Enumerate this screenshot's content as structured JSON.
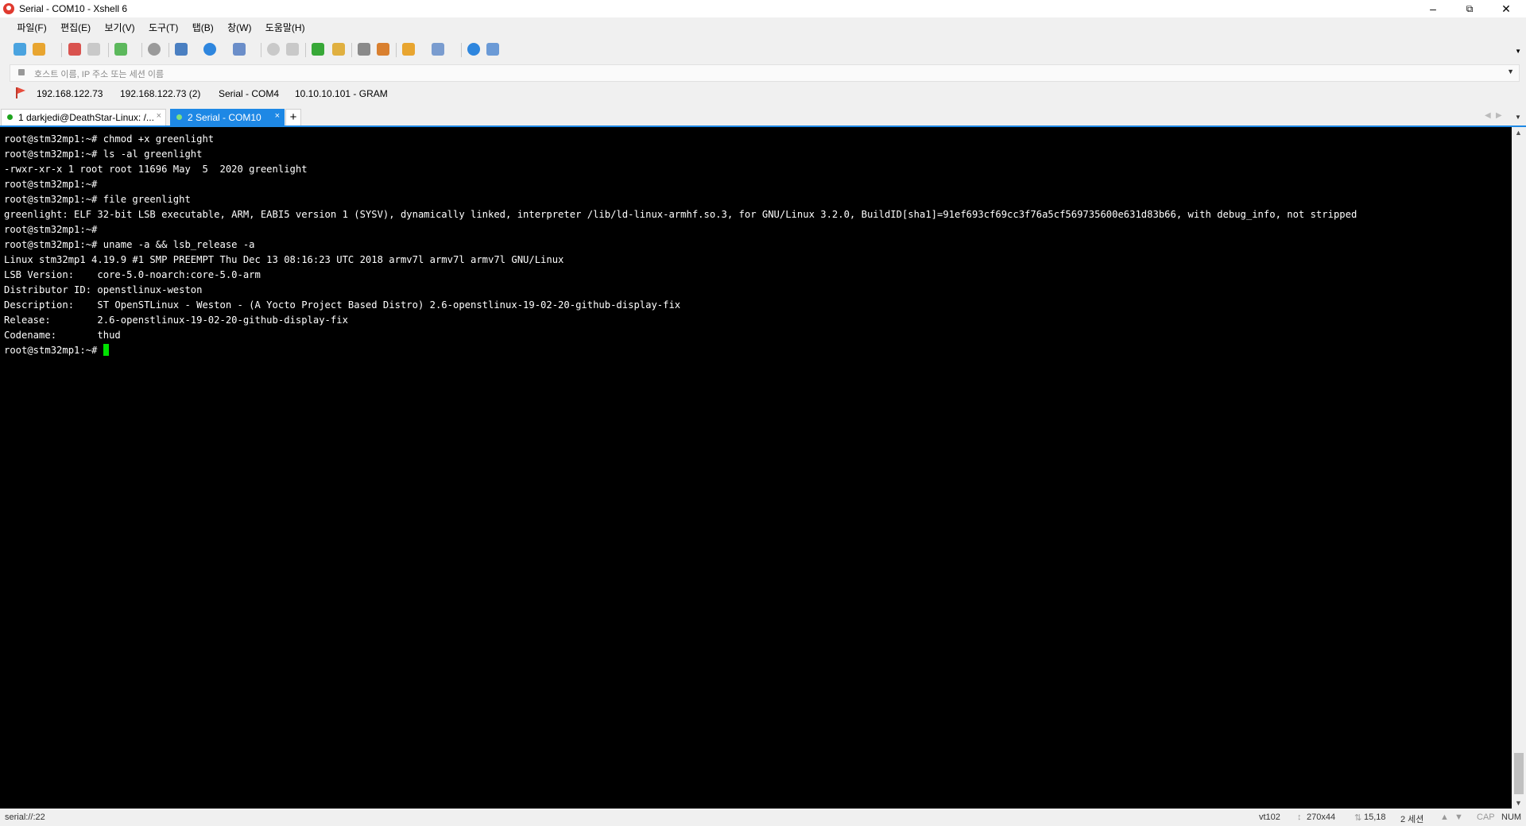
{
  "window": {
    "title": "Serial - COM10 - Xshell 6"
  },
  "menu": [
    "파일(F)",
    "편집(E)",
    "보기(V)",
    "도구(T)",
    "탭(B)",
    "창(W)",
    "도움말(H)"
  ],
  "address": {
    "placeholder": "호스트 이름, IP 주소 또는 세션 이름"
  },
  "links": [
    "192.168.122.73",
    "192.168.122.73 (2)",
    "Serial - COM4",
    "10.10.10.101 - GRAM"
  ],
  "tabs": [
    {
      "label": "1 darkjedi@DeathStar-Linux: /...",
      "active": false
    },
    {
      "label": "2 Serial - COM10",
      "active": true
    }
  ],
  "terminal": {
    "lines": [
      "root@stm32mp1:~# chmod +x greenlight",
      "root@stm32mp1:~# ls -al greenlight",
      "-rwxr-xr-x 1 root root 11696 May  5  2020 greenlight",
      "root@stm32mp1:~#",
      "root@stm32mp1:~# file greenlight",
      "greenlight: ELF 32-bit LSB executable, ARM, EABI5 version 1 (SYSV), dynamically linked, interpreter /lib/ld-linux-armhf.so.3, for GNU/Linux 3.2.0, BuildID[sha1]=91ef693cf69cc3f76a5cf569735600e631d83b66, with debug_info, not stripped",
      "root@stm32mp1:~#",
      "root@stm32mp1:~# uname -a && lsb_release -a",
      "Linux stm32mp1 4.19.9 #1 SMP PREEMPT Thu Dec 13 08:16:23 UTC 2018 armv7l armv7l armv7l GNU/Linux",
      "LSB Version:    core-5.0-noarch:core-5.0-arm",
      "Distributor ID: openstlinux-weston",
      "Description:    ST OpenSTLinux - Weston - (A Yocto Project Based Distro) 2.6-openstlinux-19-02-20-github-display-fix",
      "Release:        2.6-openstlinux-19-02-20-github-display-fix",
      "Codename:       thud"
    ],
    "prompt": "root@stm32mp1:~# ",
    "cursor_color": "#00e000"
  },
  "status": {
    "connection": "serial://:22",
    "term_type": "vt102",
    "size": "270x44",
    "position": "15,18",
    "sessions": "2 세션",
    "cap": "CAP",
    "num": "NUM"
  },
  "colors": {
    "accent": "#1e88e5",
    "terminal_bg": "#000000",
    "terminal_fg": "#ffffff",
    "status_dot": "#1da31d"
  }
}
